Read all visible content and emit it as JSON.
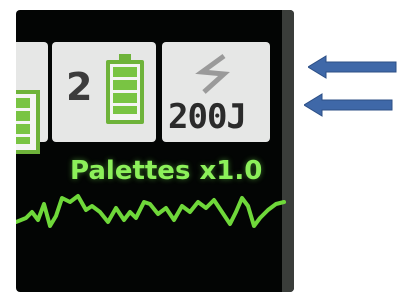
{
  "colors": {
    "screen_bg": "#030504",
    "tile_bg": "#e6e7e6",
    "battery_green": "#79c443",
    "label_green": "#8cf05a",
    "ecg_green": "#6fd83a",
    "arrow_fill": "#3f68a8"
  },
  "status_bar": {
    "battery_2": {
      "label": "2",
      "icon": "battery-full-icon",
      "level": 1.0
    },
    "energy": {
      "icon": "lightning-bolt-icon",
      "value": "200J"
    },
    "battery_1": {
      "icon": "battery-full-icon",
      "level": 1.0
    }
  },
  "waveform": {
    "label": "Palettes x1.0",
    "icon": "ecg-waveform"
  },
  "annotations": {
    "arrows": [
      {
        "icon": "arrow-left-icon"
      },
      {
        "icon": "arrow-left-icon"
      }
    ]
  }
}
